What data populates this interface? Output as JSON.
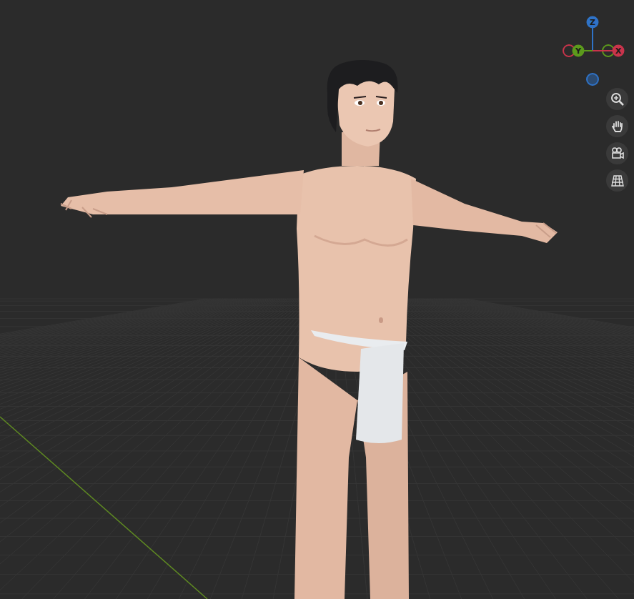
{
  "viewport": {
    "gizmo": {
      "axes": [
        {
          "label": "Z",
          "color": "#2f73c8"
        },
        {
          "label": "Y",
          "color": "#5c9a1c"
        },
        {
          "label": "X",
          "color": "#c9344b"
        }
      ]
    }
  }
}
